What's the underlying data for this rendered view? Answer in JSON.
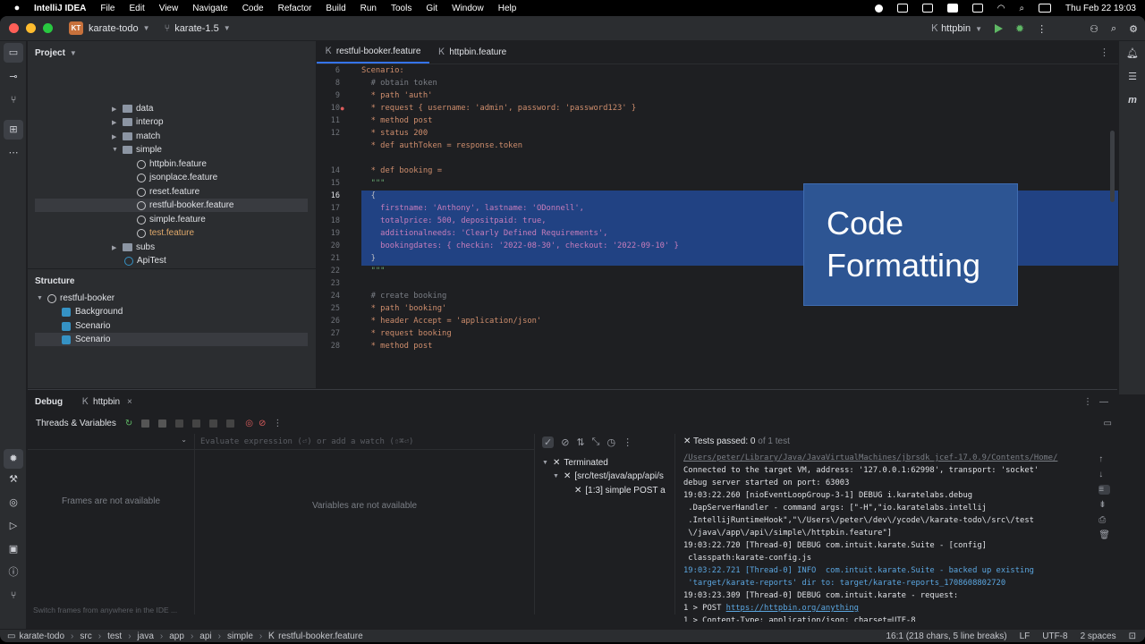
{
  "menubar": {
    "app": "IntelliJ IDEA",
    "items": [
      "File",
      "Edit",
      "View",
      "Navigate",
      "Code",
      "Refactor",
      "Build",
      "Run",
      "Tools",
      "Git",
      "Window",
      "Help"
    ],
    "clock": "Thu Feb 22  19:03"
  },
  "titlebar": {
    "project_badge": "KT",
    "project": "karate-todo",
    "branch": "karate-1.5",
    "run_config": "httpbin"
  },
  "project_panel": {
    "title": "Project",
    "rows": [
      "data",
      "interop",
      "match",
      "simple",
      "httpbin.feature",
      "jsonplace.feature",
      "reset.feature",
      "restful-booker.feature",
      "simple.feature",
      "test.feature",
      "subs",
      "ApiTest"
    ]
  },
  "structure_panel": {
    "title": "Structure",
    "root": "restful-booker",
    "items": [
      "Background",
      "Scenario",
      "Scenario"
    ]
  },
  "editor": {
    "tabs": [
      "restful-booker.feature",
      "httpbin.feature"
    ],
    "line_numbers": [
      "6",
      "8",
      "9",
      "10",
      "11",
      "12",
      "14",
      "15",
      "16",
      "17",
      "18",
      "19",
      "20",
      "21",
      "22",
      "23",
      "24",
      "25",
      "26",
      "27",
      "28"
    ],
    "lines": [
      "Scenario:",
      "  # obtain token",
      "  * path 'auth'",
      "  * request { username: 'admin', password: 'password123' }",
      "  * method post",
      "  * status 200",
      "  * def authToken = response.token",
      "",
      "  * def booking =",
      "  \"\"\"",
      "  {",
      "    firstname: 'Anthony', lastname: 'ODonnell',",
      "    totalprice: 500, depositpaid: true,",
      "    additionalneeds: 'Clearly Defined Requirements',",
      "    bookingdates: { checkin: '2022-08-30', checkout: '2022-09-10' }",
      "  }",
      "  \"\"\"",
      "",
      "  # create booking",
      "  * path 'booking'",
      "  * header Accept = 'application/json'",
      "  * request booking",
      "  * method post"
    ],
    "overlay_line1": "Code",
    "overlay_line2": "Formatting"
  },
  "debug": {
    "title": "Debug",
    "session_tab": "httpbin",
    "threads_label": "Threads & Variables",
    "eval_placeholder": "Evaluate expression (⏎) or add a watch (⇧⌘⏎)",
    "frames_empty": "Frames are not available",
    "vars_empty": "Variables are not available",
    "switch_hint": "Switch frames from anywhere in the IDE ...",
    "tests_passed_label": "Tests passed:",
    "tests_passed_count": "0",
    "tests_total": "of 1 test",
    "test_tree": [
      "Terminated",
      "[src/test/java/app/api/s",
      "[1:3] simple POST a"
    ],
    "console": [
      "/Users/peter/Library/Java/JavaVirtualMachines/jbrsdk_jcef-17.0.9/Contents/Home/",
      "Connected to the target VM, address: '127.0.0.1:62998', transport: 'socket'",
      "debug server started on port: 63003",
      "19:03:22.260 [nioEventLoopGroup-3-1] DEBUG i.karatelabs.debug",
      " .DapServerHandler - command args: [\"-H\",\"io.karatelabs.intellij",
      " .IntellijRuntimeHook\",\"\\/Users\\/peter\\/dev\\/ycode\\/karate-todo\\/src\\/test",
      " \\/java\\/app\\/api\\/simple\\/httpbin.feature\"]",
      "19:03:22.720 [Thread-0] DEBUG com.intuit.karate.Suite - [config]",
      " classpath:karate-config.js",
      "19:03:22.721 [Thread-0] INFO  com.intuit.karate.Suite - backed up existing",
      " 'target/karate-reports' dir to: target/karate-reports_1708608802720",
      "19:03:23.309 [Thread-0] DEBUG com.intuit.karate - request:",
      "1 > POST ",
      "https://httpbin.org/anything",
      "1 > Content-Type: application/json; charset=UTF-8"
    ]
  },
  "statusbar": {
    "breadcrumb": [
      "karate-todo",
      "src",
      "test",
      "java",
      "app",
      "api",
      "simple",
      "restful-booker.feature"
    ],
    "position": "16:1 (218 chars, 5 line breaks)",
    "line_sep": "LF",
    "encoding": "UTF-8",
    "indent": "2 spaces"
  },
  "colors": {
    "accent": "#3574f0",
    "selection": "#214283",
    "overlay": "#2d5593",
    "run": "#5fb865"
  }
}
